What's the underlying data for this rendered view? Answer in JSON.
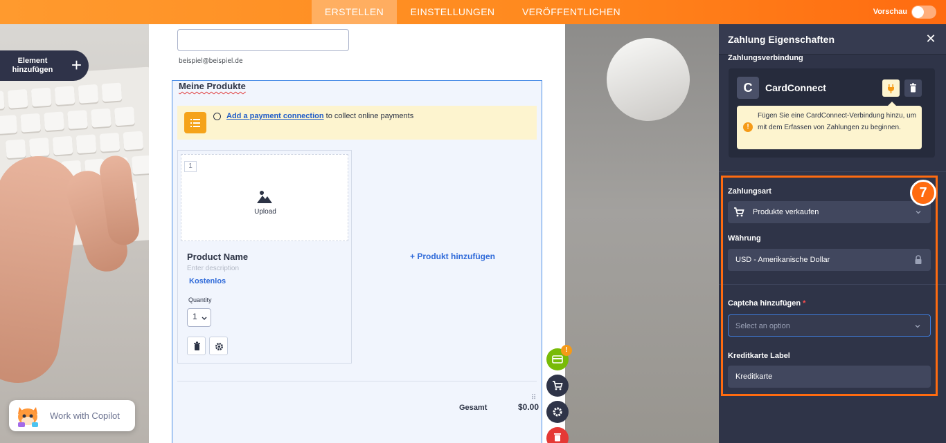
{
  "topbar": {
    "tabs": [
      "ERSTELLEN",
      "EINSTELLUNGEN",
      "VERÖFFENTLICHEN"
    ],
    "active_tab": "ERSTELLEN",
    "preview_label": "Vorschau",
    "preview_on": false
  },
  "sidebar": {
    "add_element_label": "Element hinzufügen"
  },
  "copilot": {
    "label": "Work with Copilot"
  },
  "form": {
    "email_sublabel": "beispiel@beispiel.de",
    "products_title": "Meine Produkte",
    "notice": {
      "link": "Add a payment connection",
      "text": " to collect online payments"
    },
    "product": {
      "index": "1",
      "upload_label": "Upload",
      "name": "Product Name",
      "description_placeholder": "Enter description",
      "price": "Kostenlos",
      "quantity_label": "Quantity",
      "quantity_value": "1"
    },
    "add_product_label": "+ Produkt hinzufügen",
    "total_label": "Gesamt",
    "total_value": "$0.00"
  },
  "floating_actions": {
    "badge": "!"
  },
  "panel": {
    "title": "Zahlung Eigenschaften",
    "connection_label": "Zahlungsverbindung",
    "connection_logo": "C",
    "connection_name": "CardConnect",
    "connection_tip": "Fügen Sie eine CardConnect-Verbindung hinzu, um mit dem Erfassen von Zahlungen zu beginnen.",
    "payment_type_label": "Zahlungsart",
    "payment_type_value": "Produkte verkaufen",
    "currency_label": "Währung",
    "currency_value": "USD - Amerikanische Dollar",
    "captcha_label": "Captcha hinzufügen",
    "captcha_required": "*",
    "captcha_placeholder": "Select an option",
    "card_label_label": "Kreditkarte Label",
    "card_label_value": "Kreditkarte",
    "step_number": "7"
  },
  "colors": {
    "accent_orange": "#ff6b10",
    "panel_bg": "#2f3448",
    "link_blue": "#1e5bc8",
    "notice_yellow": "#fdf4cf"
  }
}
